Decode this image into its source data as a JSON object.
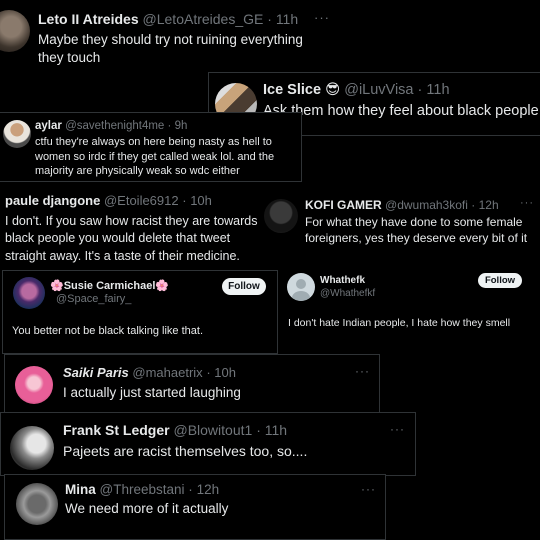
{
  "tweets": [
    {
      "name": "Leto II Atreides",
      "handle": "@LetoAtreides_GE",
      "time": "11h",
      "text": "Maybe they should try not ruining everything they touch"
    },
    {
      "name": "Ice Slice",
      "emoji": "😎",
      "handle": "@iLuvVisa",
      "time": "11h",
      "text": "Ask them how they feel about black people"
    },
    {
      "name": "aylar",
      "handle": "@savethenight4me",
      "time": "9h",
      "text": "ctfu they're always on here being nasty as hell to women so irdc if they get called weak lol. and the majority are physically weak so wdc either"
    },
    {
      "name": "paule djangone",
      "handle": "@Etoile6912",
      "time": "10h",
      "text": "I don't. If you saw how racist they are towards black people you would delete that tweet straight away. It's a taste of their medicine."
    },
    {
      "name": "KOFI GAMER",
      "handle": "@dwumah3kofi",
      "time": "12h",
      "text": "For what they have done to some female foreigners, yes they deserve every bit of it"
    },
    {
      "name": "Susie Carmichael",
      "handle": "@Space_fairy_",
      "flower": "🌸",
      "text": "You better not be black talking like that.",
      "follow": "Follow"
    },
    {
      "name": "Whathefk",
      "handle": "@Whathefkf",
      "text": "I don't hate Indian people, I hate how they smell",
      "follow": "Follow"
    },
    {
      "name": "Saiki Paris",
      "handle": "@mahaetrix",
      "time": "10h",
      "text": "I actually just started laughing"
    },
    {
      "name": "Frank St Ledger",
      "handle": "@Blowitout1",
      "time": "11h",
      "text": "Pajeets are racist themselves too, so...."
    },
    {
      "name": "Mina",
      "handle": "@Threebstani",
      "time": "12h",
      "text": "We need more of it actually"
    }
  ],
  "ui": {
    "more": "···",
    "sep": "·",
    "accent": "#e7e9ea",
    "muted": "#71767b",
    "follow_bg": "#eff3f4"
  }
}
